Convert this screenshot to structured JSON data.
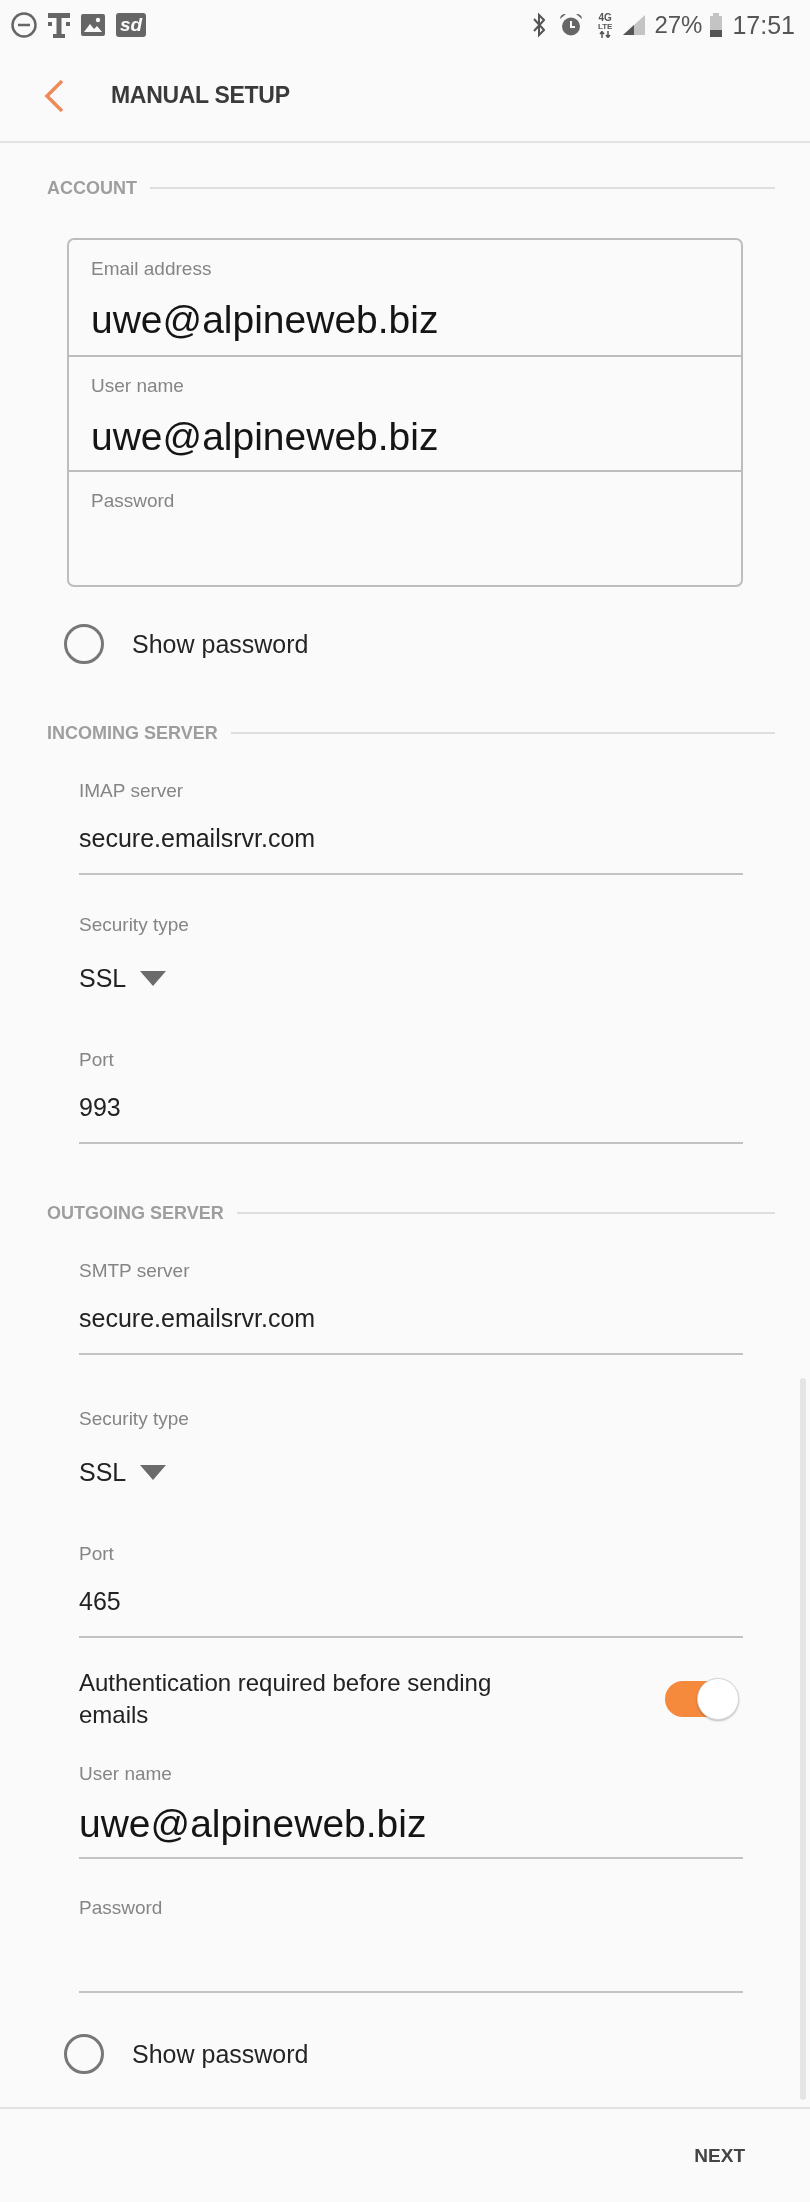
{
  "status_bar": {
    "notification_badge": "sd",
    "network_generation": "4G",
    "network_technology": "LTE",
    "battery": "27%",
    "time": "17:51"
  },
  "header": {
    "title": "MANUAL SETUP"
  },
  "sections": [
    {
      "kind": "boxed",
      "title": "ACCOUNT",
      "fields": [
        {
          "kind": "email",
          "label": "Email address",
          "value": "uwe@alpineweb.biz"
        },
        {
          "kind": "email",
          "label": "User name",
          "value": "uwe@alpineweb.biz"
        },
        {
          "kind": "password",
          "label": "Password"
        }
      ],
      "show_password": {
        "label": "Show password",
        "checked": false
      }
    },
    {
      "kind": "plain",
      "title": "INCOMING SERVER",
      "fields": [
        {
          "kind": "text",
          "label": "IMAP server",
          "value": "secure.emailsrvr.com"
        },
        {
          "kind": "dropdown",
          "label": "Security type",
          "value": "SSL"
        },
        {
          "kind": "text",
          "label": "Port",
          "value": "993"
        }
      ]
    },
    {
      "kind": "plain",
      "title": "OUTGOING SERVER",
      "fields": [
        {
          "kind": "text",
          "label": "SMTP server",
          "value": "secure.emailsrvr.com"
        },
        {
          "kind": "dropdown",
          "label": "Security type",
          "value": "SSL"
        },
        {
          "kind": "text",
          "label": "Port",
          "value": "465"
        },
        {
          "kind": "switch",
          "label": "Authentication required before sending emails",
          "on": true
        },
        {
          "kind": "email",
          "label": "User name",
          "value": "uwe@alpineweb.biz"
        },
        {
          "kind": "password",
          "label": "Password"
        }
      ],
      "show_password": {
        "label": "Show password",
        "checked": false
      }
    }
  ],
  "footer": {
    "next_button": "NEXT"
  }
}
